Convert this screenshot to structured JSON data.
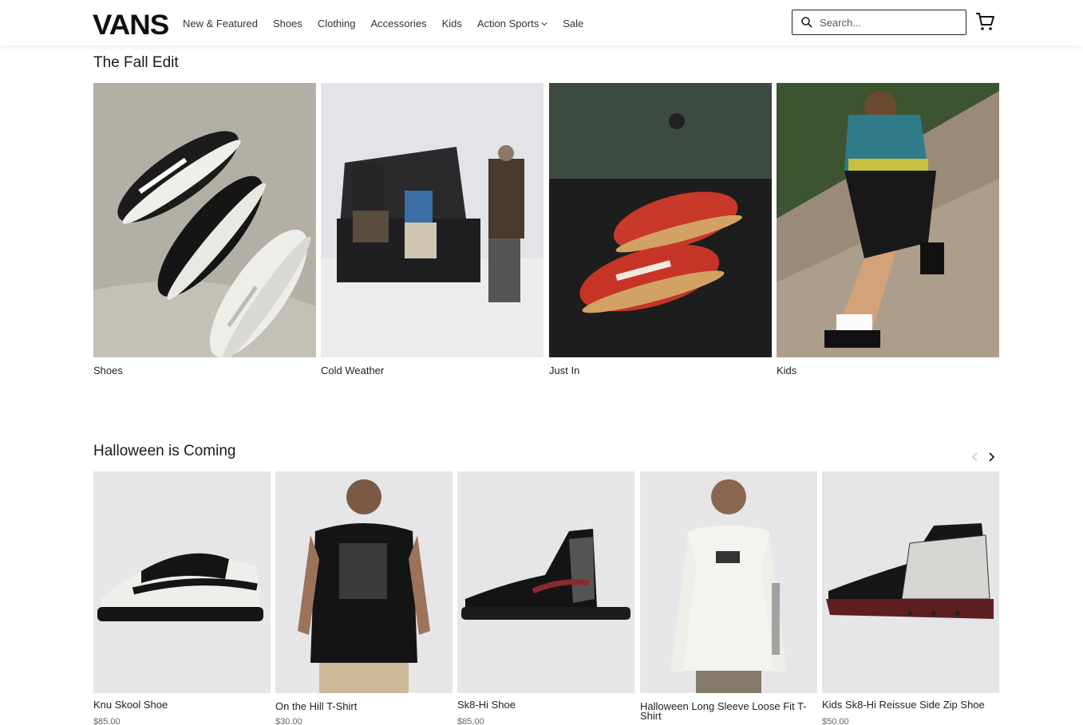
{
  "header": {
    "logo": "VANS",
    "nav": [
      "New & Featured",
      "Shoes",
      "Clothing",
      "Accessories",
      "Kids",
      "Action Sports",
      "Sale"
    ],
    "search_placeholder": "Search..."
  },
  "fall_edit": {
    "title": "The Fall Edit",
    "tiles": [
      {
        "label": "Shoes"
      },
      {
        "label": "Cold Weather"
      },
      {
        "label": "Just In"
      },
      {
        "label": "Kids"
      }
    ]
  },
  "halloween": {
    "title": "Halloween is Coming",
    "products": [
      {
        "name": "Knu Skool Shoe",
        "price": "$85.00"
      },
      {
        "name": "On the Hill T-Shirt",
        "price": "$30.00"
      },
      {
        "name": "Sk8-Hi Shoe",
        "price": "$85.00"
      },
      {
        "name": "Halloween Long Sleeve Loose Fit T-Shirt",
        "price": ""
      },
      {
        "name": "Kids Sk8-Hi Reissue Side Zip Shoe",
        "price": "$50.00"
      }
    ]
  },
  "icons": {
    "search": "search-icon",
    "cart": "cart-icon",
    "prev": "chevron-left-icon",
    "next": "chevron-right-icon",
    "dropdown": "chevron-down-icon"
  }
}
